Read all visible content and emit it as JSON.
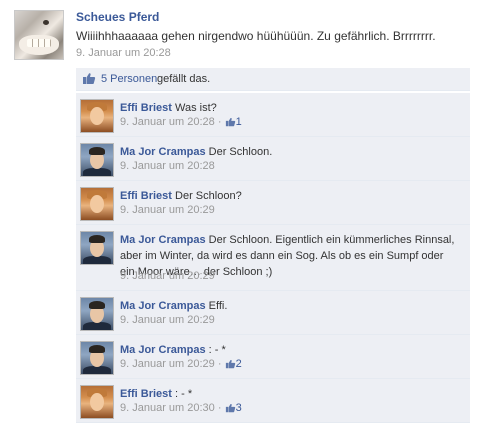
{
  "post": {
    "author": "Scheues Pferd",
    "text": "Wiiiihhhaaaaaa gehen nirgendwo hüühüüün. Zu gefährlich. Brrrrrrrr.",
    "time": "9. Januar um 20:28"
  },
  "likes": {
    "count_link": "5 Personen",
    "suffix": "gefällt das."
  },
  "comments": [
    {
      "author": "Effi Briest",
      "text": "Was ist?",
      "time": "9. Januar um 20:28",
      "likes": "1"
    },
    {
      "author": "Ma Jor Crampas",
      "text": "Der Schloon.",
      "time": "9. Januar um 20:28",
      "likes": ""
    },
    {
      "author": "Effi Briest",
      "text": "Der Schloon?",
      "time": "9. Januar um 20:29",
      "likes": ""
    },
    {
      "author": "Ma Jor Crampas",
      "text": "Der Schloon. Eigentlich ein kümmerliches Rinnsal, aber im Winter, da wird es dann ein Sog. Als ob es ein Sumpf oder ein Moor wäre… der Schloon ;)",
      "time": "9. Januar um 20:29",
      "likes": ""
    },
    {
      "author": "Ma Jor Crampas",
      "text": "Effi.",
      "time": "9. Januar um 20:29",
      "likes": ""
    },
    {
      "author": "Ma Jor Crampas",
      "text": ": - *",
      "time": "9. Januar um 20:29",
      "likes": "2"
    },
    {
      "author": "Effi Briest",
      "text": ": - *",
      "time": "9. Januar um 20:30",
      "likes": "3"
    }
  ],
  "icons": {
    "like": "thumbs-up-icon"
  },
  "colors": {
    "link": "#3b5998",
    "comment_bg": "#edeff4",
    "meta": "#999999"
  }
}
